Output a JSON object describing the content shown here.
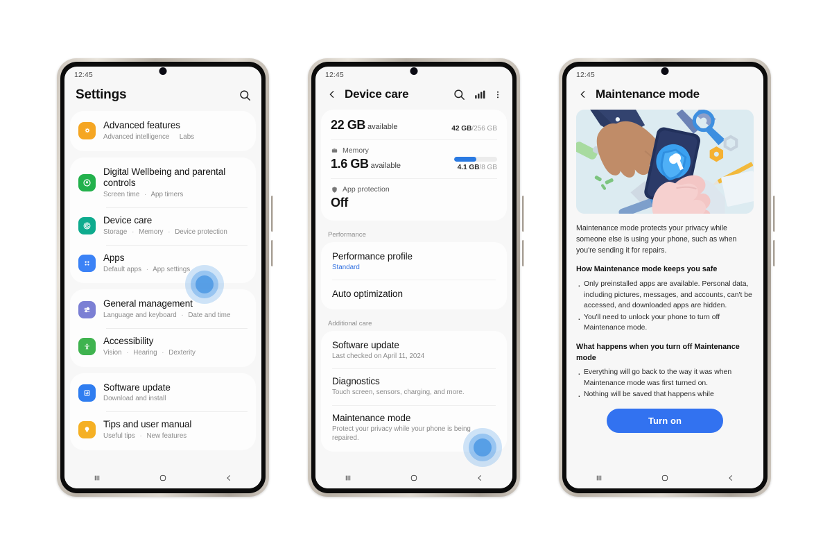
{
  "canvas": {
    "background": "#ffffff"
  },
  "phones": [
    {
      "status_time": "12:45",
      "header": {
        "title": "Settings",
        "search_icon": "search-icon"
      },
      "groups": [
        {
          "items": [
            {
              "title": "Advanced features",
              "subtitle_parts": [
                "Advanced intelligence",
                "Labs"
              ],
              "icon": "sparkle-gear-icon",
              "icon_color": "#f5a623"
            }
          ]
        },
        {
          "items": [
            {
              "title": "Digital Wellbeing and parental controls",
              "subtitle_parts": [
                "Screen time",
                "App timers"
              ],
              "icon": "wellbeing-icon",
              "icon_color": "#23b14c"
            },
            {
              "title": "Device care",
              "subtitle_parts": [
                "Storage",
                "Memory",
                "Device protection"
              ],
              "icon": "device-care-icon",
              "icon_color": "#0eab8e"
            },
            {
              "title": "Apps",
              "subtitle_parts": [
                "Default apps",
                "App settings"
              ],
              "icon": "apps-grid-icon",
              "icon_color": "#3b82f6"
            }
          ]
        },
        {
          "items": [
            {
              "title": "General management",
              "subtitle_parts": [
                "Language and keyboard",
                "Date and time"
              ],
              "icon": "sliders-icon",
              "icon_color": "#7b7fd4"
            },
            {
              "title": "Accessibility",
              "subtitle_parts": [
                "Vision",
                "Hearing",
                "Dexterity"
              ],
              "icon": "accessibility-icon",
              "icon_color": "#3fb34f"
            }
          ]
        },
        {
          "items": [
            {
              "title": "Software update",
              "subtitle_parts": [
                "Download and install"
              ],
              "icon": "software-update-icon",
              "icon_color": "#2f7df0"
            },
            {
              "title": "Tips and user manual",
              "subtitle_parts": [
                "Useful tips",
                "New features"
              ],
              "icon": "lightbulb-icon",
              "icon_color": "#f5b024"
            }
          ]
        }
      ],
      "tap_target": "Device care"
    },
    {
      "status_time": "12:45",
      "header": {
        "title": "Device care",
        "back_icon": "back-chevron-icon",
        "actions": [
          "search-icon",
          "bar-chart-icon",
          "overflow-menu-icon"
        ]
      },
      "status_card": {
        "storage": {
          "value": "22 GB",
          "unit_label": "available",
          "used": "42 GB",
          "total": "/256 GB"
        },
        "memory": {
          "label": "Memory",
          "icon": "memory-chip-icon",
          "value": "1.6 GB",
          "unit_label": "available",
          "used": "4.1 GB",
          "total": "/8 GB",
          "bar_percent": 51
        },
        "app_protection": {
          "label": "App protection",
          "icon": "shield-icon",
          "value": "Off"
        }
      },
      "sections": [
        {
          "heading": "Performance",
          "rows": [
            {
              "title": "Performance profile",
              "subtitle": "Standard",
              "subtitle_accent": true
            },
            {
              "title": "Auto optimization",
              "subtitle": ""
            }
          ]
        },
        {
          "heading": "Additional care",
          "rows": [
            {
              "title": "Software update",
              "subtitle": "Last checked on April 11, 2024"
            },
            {
              "title": "Diagnostics",
              "subtitle": "Touch screen, sensors, charging, and more."
            },
            {
              "title": "Maintenance mode",
              "subtitle": "Protect your privacy while your phone is being repaired."
            }
          ]
        }
      ],
      "tap_target": "Maintenance mode"
    },
    {
      "status_time": "12:45",
      "header": {
        "title": "Maintenance mode",
        "back_icon": "back-chevron-icon"
      },
      "illustration": "repair-hands-phone-illustration",
      "intro": "Maintenance mode protects your privacy while someone else is using your phone, such as when you're sending it for repairs.",
      "section1": {
        "heading": "How Maintenance mode keeps you safe",
        "bullets": [
          "Only preinstalled apps are available. Personal data, including pictures, messages, and accounts, can't be accessed, and downloaded apps are hidden.",
          "You'll need to unlock your phone to turn off Maintenance mode."
        ]
      },
      "section2": {
        "heading": "What happens when you turn off Maintenance mode",
        "bullets": [
          "Everything will go back to the way it was when Maintenance mode was first turned on.",
          "Nothing will be saved that happens while"
        ]
      },
      "cta_label": "Turn on"
    }
  ],
  "navbar": {
    "recents_icon": "recents-icon",
    "home_icon": "home-icon",
    "back_icon": "back-icon"
  },
  "colors": {
    "accent_blue": "#3272f0",
    "link_blue": "#2f6fe0",
    "bar_blue": "#2a7ae2",
    "screen_bg": "#f7f7f7",
    "card_bg": "#fdfdfd"
  }
}
